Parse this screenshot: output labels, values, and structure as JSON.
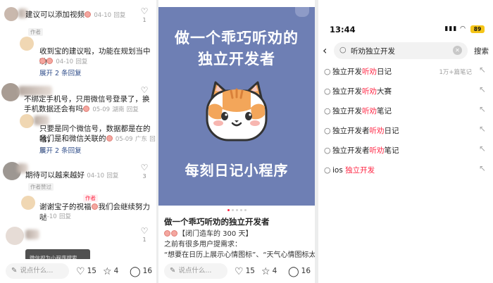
{
  "comments_panel": {
    "items": [
      {
        "text": "建议可以添加视频",
        "emoji": true,
        "date": "04-10",
        "reply": "回复",
        "likes": "1"
      },
      {
        "tag": "作者",
        "text": "收到宝的建议啦，功能在规划当中哟",
        "date": "04-10",
        "reply": "回复",
        "expand": "展开 2 条回复"
      },
      {
        "text_1": "不绑定手机号，只用微信号登录了，换",
        "text_2": "手机数据还会有吗",
        "date": "05-09",
        "location": "湖南",
        "reply": "回复",
        "likes": "1"
      },
      {
        "text_1": "只要是同个微信号，数据都是在的哈，",
        "text_2": "我们是和微信关联的",
        "date": "05-09",
        "location": "广东",
        "reply": "回复",
        "expand": "展开 2 条回复"
      },
      {
        "text": "期待可以越来越好",
        "date": "04-10",
        "reply": "回复",
        "likes": "3"
      },
      {
        "tag": "作者赞过",
        "text": "谢谢宝子的祝福",
        "text_b": "我们会继续努力哒",
        "date": "04-10",
        "reply": "回复",
        "tag_top": "作者"
      },
      {
        "likes": "1",
        "bubble": "微信视为小程序搜索..."
      }
    ],
    "bottom": {
      "placeholder": "说点什么...",
      "likes": "15",
      "stars": "4",
      "comments": "16"
    }
  },
  "post_panel": {
    "cover": {
      "title": "做一个乖巧听劝的",
      "title2": "独立开发者",
      "subtitle": "每刻日记小程序"
    },
    "title": "做一个乖巧听劝的独立开发者",
    "line1": "【闭门造车的 300 天】",
    "line2": "之前有很多用户提需求：",
    "line3": "“想要在日历上展示心情图标”、“天气心情图标太",
    "bottom": {
      "placeholder": "说点什么...",
      "likes": "15",
      "stars": "4",
      "comments": "16"
    }
  },
  "search_panel": {
    "time": "13:44",
    "battery": "89",
    "query": "听劝独立开发",
    "search_button": "搜索",
    "suggestions": [
      {
        "pre": "独立开发",
        "hl": "听劝",
        "post": "日记",
        "count": "1万+篇笔记"
      },
      {
        "pre": "独立开发",
        "hl": "听劝",
        "post": "大赛",
        "count": ""
      },
      {
        "pre": "独立开发",
        "hl": "听劝",
        "post": "笔记",
        "count": ""
      },
      {
        "pre": "独立开发者",
        "hl": "听劝",
        "post": "日记",
        "count": ""
      },
      {
        "pre": "独立开发者",
        "hl": "听劝",
        "post": "笔记",
        "count": ""
      },
      {
        "pre": "ios ",
        "hl": "独立开发",
        "post": "",
        "count": ""
      }
    ]
  },
  "colors": {
    "accent": "#ff2442",
    "cover_bg": "#6e7fb4",
    "link": "#2f4d8a"
  },
  "icons": [
    "heart-icon",
    "star-icon",
    "comment-icon",
    "search-icon",
    "back-arrow-icon",
    "clear-icon",
    "fill-arrow-icon",
    "pen-icon",
    "cat-mascot-icon"
  ]
}
